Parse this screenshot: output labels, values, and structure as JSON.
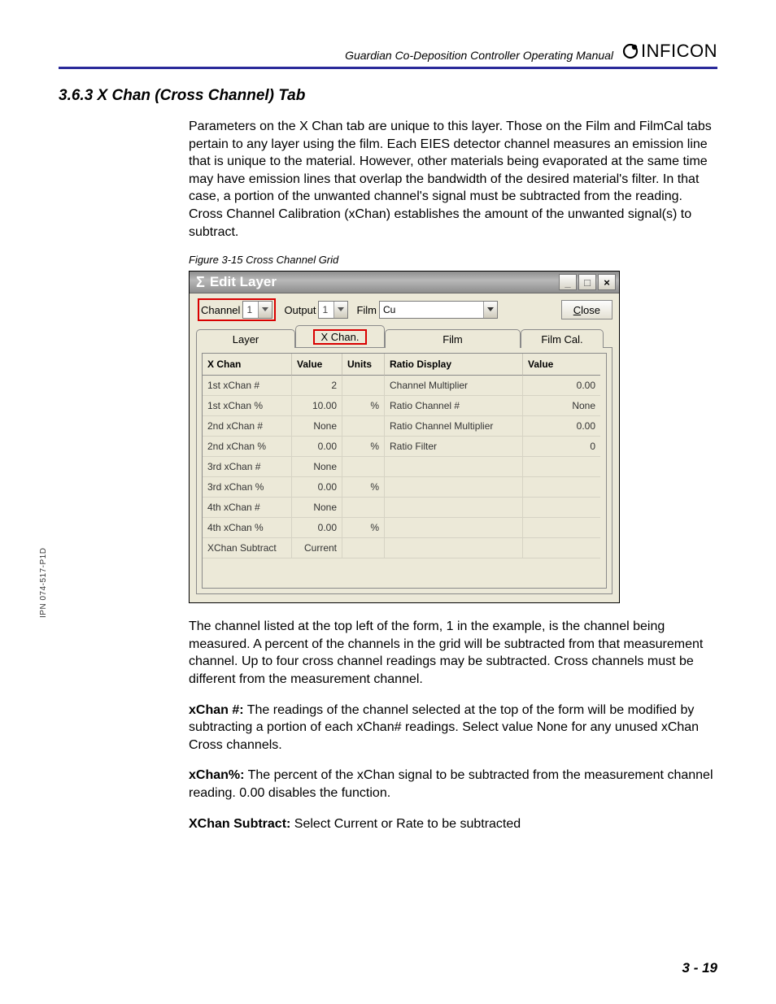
{
  "header": {
    "running_title": "Guardian Co-Deposition Controller Operating Manual",
    "brand": "INFICON"
  },
  "section": {
    "number_title": "3.6.3  X Chan (Cross Channel) Tab",
    "para1": "Parameters on the X Chan tab are unique to this layer. Those on the Film and FilmCal tabs pertain to any layer using the film. Each EIES detector channel measures an emission line that is unique to the material. However, other materials being evaporated at the same time may have emission lines that overlap the bandwidth of the desired material's filter. In that case, a portion of the unwanted channel's signal must be subtracted from the reading. Cross Channel Calibration (xChan) establishes the amount of the unwanted signal(s) to subtract.",
    "figure_caption": "Figure 3-15  Cross Channel Grid",
    "para2": "The channel listed at the top left of the form, 1 in the example, is the channel being measured. A percent of the channels in the grid will be subtracted from that measurement channel. Up to four cross channel readings may be subtracted. Cross channels must be different from the measurement channel.",
    "defs": [
      {
        "term": "xChan #:",
        "text": " The readings of the channel selected at the top of the form will be modified by subtracting a portion of each xChan# readings. Select value None for any unused xChan Cross channels."
      },
      {
        "term": "xChan%:",
        "text": " The percent of the xChan signal to be subtracted from the measurement channel reading. 0.00 disables the function."
      },
      {
        "term": "XChan Subtract:",
        "text": " Select Current or Rate to be subtracted"
      }
    ]
  },
  "window": {
    "title_sigma": "Σ",
    "title": "Edit Layer",
    "win_min": "_",
    "win_max": "□",
    "win_close": "×",
    "toolbar": {
      "channel_label": "Channel",
      "channel_value": "1",
      "output_label": "Output",
      "output_value": "1",
      "film_label": "Film",
      "film_value": "Cu",
      "close_u": "C",
      "close_rest": "lose"
    },
    "tabs": {
      "layer": "Layer",
      "xchan": "X Chan.",
      "film": "Film",
      "filmcal": "Film Cal."
    },
    "grid": {
      "headers": {
        "c1": "X Chan",
        "c2": "Value",
        "c3": "Units",
        "c4": "Ratio Display",
        "c5": "Value"
      },
      "rows": [
        {
          "c1": "1st xChan #",
          "c2": "2",
          "c3": "",
          "c4": "Channel Multiplier",
          "c5": "0.00"
        },
        {
          "c1": "1st xChan %",
          "c2": "10.00",
          "c3": "%",
          "c4": "Ratio Channel #",
          "c5": "None"
        },
        {
          "c1": "2nd xChan #",
          "c2": "None",
          "c3": "",
          "c4": "Ratio Channel Multiplier",
          "c5": "0.00"
        },
        {
          "c1": "2nd xChan %",
          "c2": "0.00",
          "c3": "%",
          "c4": "Ratio Filter",
          "c5": "0"
        },
        {
          "c1": "3rd xChan #",
          "c2": "None",
          "c3": "",
          "c4": "",
          "c5": ""
        },
        {
          "c1": "3rd xChan %",
          "c2": "0.00",
          "c3": "%",
          "c4": "",
          "c5": ""
        },
        {
          "c1": "4th xChan #",
          "c2": "None",
          "c3": "",
          "c4": "",
          "c5": ""
        },
        {
          "c1": "4th xChan %",
          "c2": "0.00",
          "c3": "%",
          "c4": "",
          "c5": ""
        },
        {
          "c1": "XChan Subtract",
          "c2": "Current",
          "c3": "",
          "c4": "",
          "c5": ""
        }
      ]
    }
  },
  "side_ipn": "IPN 074-517-P1D",
  "page_number": "3 - 19"
}
